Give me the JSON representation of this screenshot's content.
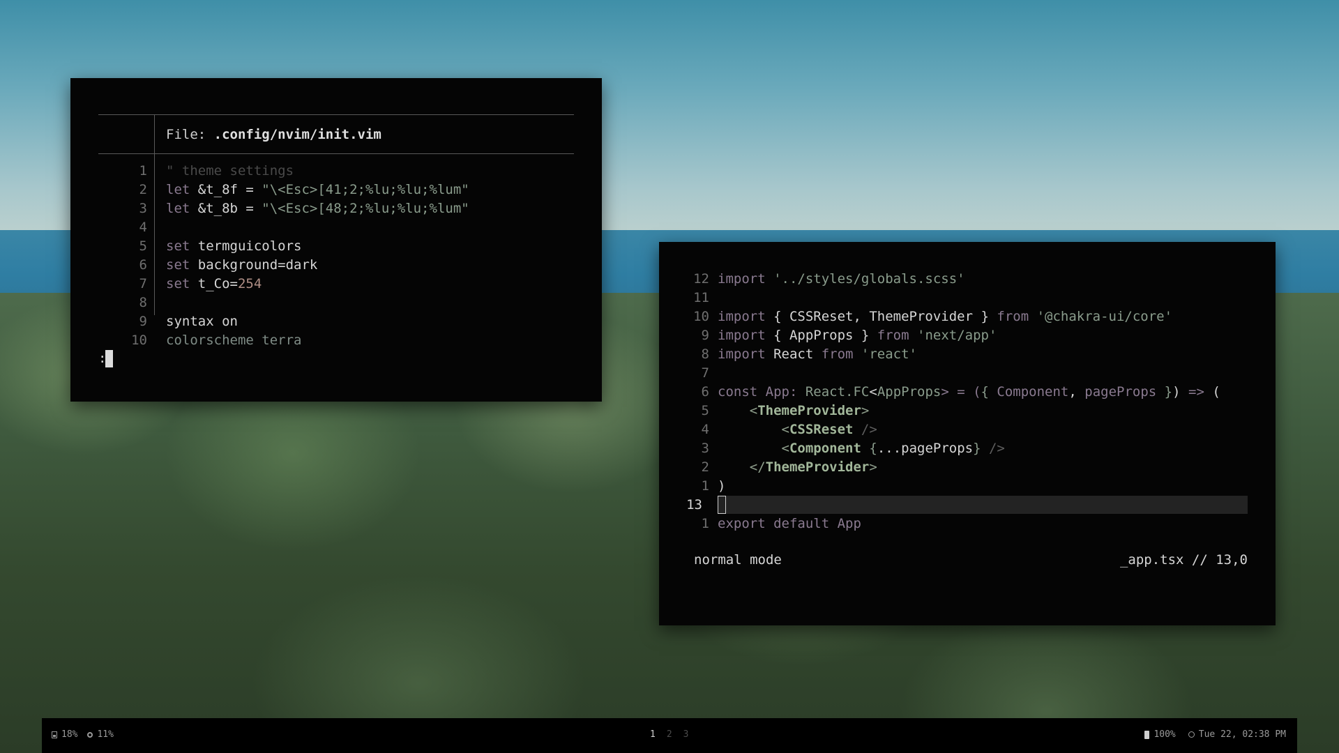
{
  "left_editor": {
    "header_prefix": "File: ",
    "file_path": ".config/nvim/init.vim",
    "line_numbers": [
      "1",
      "2",
      "3",
      "4",
      "5",
      "6",
      "7",
      "8",
      "9",
      "10"
    ],
    "lines": {
      "l1": "\" theme settings",
      "l2_kw": "let",
      "l2_rest": " &t_8f = ",
      "l2_str": "\"\\<Esc>[41;2;%lu;%lu;%lum\"",
      "l3_kw": "let",
      "l3_rest": " &t_8b = ",
      "l3_str": "\"\\<Esc>[48;2;%lu;%lu;%lum\"",
      "l5_kw": "set",
      "l5_rest": " termguicolors",
      "l6_kw": "set",
      "l6_rest": " background=dark",
      "l7_kw": "set",
      "l7_rest": " t_Co=",
      "l7_num": "254",
      "l9": "syntax on",
      "l10": "colorscheme terra"
    },
    "command_prompt": ":"
  },
  "right_editor": {
    "relative_numbers": [
      "12",
      "11",
      "10",
      "9",
      "8",
      "7",
      "6",
      "5",
      "4",
      "3",
      "2",
      "1",
      "13",
      "1"
    ],
    "lines": {
      "r1_kw": "import",
      "r1_str": " '../styles/globals.scss'",
      "r3_kw": "import",
      "r3_mid": " { CSSReset, ThemeProvider } ",
      "r3_from": "from",
      "r3_str": " '@chakra-ui/core'",
      "r4_kw": "import",
      "r4_mid": " { AppProps } ",
      "r4_from": "from",
      "r4_str": " 'next/app'",
      "r5_kw": "import",
      "r5_mid": " React ",
      "r5_from": "from",
      "r5_str": " 'react'",
      "r7_kw": "const",
      "r7_a": " App: ",
      "r7_b": "React.FC",
      "r7_c": "<",
      "r7_d": "AppProps",
      "r7_e": "> = (",
      "r7_f": "{ ",
      "r7_g": "Component",
      "r7_h": ", ",
      "r7_i": "pageProps",
      "r7_j": " }",
      "r7_k": ") ",
      "r7_l": "=>",
      "r7_m": " (",
      "r8_open": "    <",
      "r8_tag": "ThemeProvider",
      "r8_close": ">",
      "r9_open": "        <",
      "r9_tag": "CSSReset",
      "r9_close": " />",
      "r10_open": "        <",
      "r10_tag": "Component",
      "r10_sp": " ",
      "r10_b1": "{",
      "r10_mid": "...pageProps",
      "r10_b2": "}",
      "r10_close": " />",
      "r11_open": "    </",
      "r11_tag": "ThemeProvider",
      "r11_close": ">",
      "r12": ")",
      "r14": "export default App"
    },
    "mode": "normal mode",
    "file_position": "_app.tsx // 13,0"
  },
  "status_bar": {
    "disk": "18%",
    "cpu": "11%",
    "workspaces": [
      "1",
      "2",
      "3"
    ],
    "battery": "100%",
    "clock": "Tue 22, 02:38 PM"
  }
}
